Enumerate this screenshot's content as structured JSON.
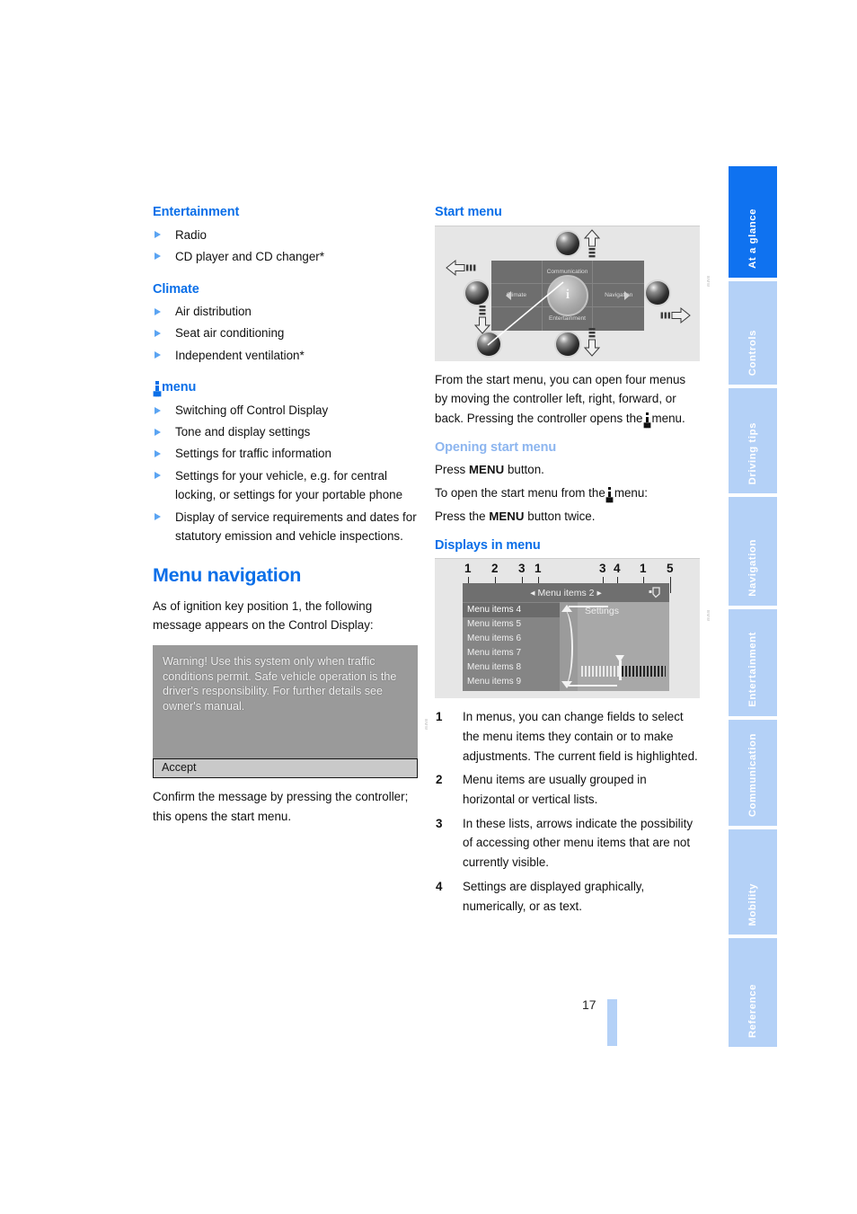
{
  "page": {
    "number": "17"
  },
  "left_column": {
    "groups": [
      {
        "heading": "Entertainment",
        "items": [
          "Radio",
          "CD player and CD changer*"
        ]
      },
      {
        "heading": "Climate",
        "items": [
          "Air distribution",
          "Seat air conditioning",
          "Independent ventilation*"
        ]
      },
      {
        "heading": "menu",
        "heading_icon": "info-i-icon",
        "items": [
          "Switching off Control Display",
          "Tone and display settings",
          "Settings for traffic information",
          "Settings for your vehicle, e.g. for central locking, or settings for your portable phone",
          "Display of service requirements and dates for statutory emission and vehicle inspections."
        ]
      }
    ],
    "section": {
      "title": "Menu navigation",
      "intro": "As of ignition key position 1, the following message appears on the Control Display:",
      "warning_screen": {
        "message": "Warning! Use this system only when traffic conditions permit. Safe vehicle operation is the driver's responsibility. For further details see owner's manual.",
        "button_label": "Accept"
      },
      "outro": "Confirm the message by pressing the controller; this opens the start menu."
    }
  },
  "right_column": {
    "start_menu": {
      "heading": "Start menu",
      "diagram": {
        "top_label": "Communication",
        "left_label": "Climate",
        "right_label": "Navigation",
        "bottom_label": "Entertainment",
        "center_label": "i"
      },
      "paragraph": "From the start menu, you can open four menus by moving the controller left, right, forward, or back. Pressing the controller opens the",
      "paragraph_tail": "menu."
    },
    "opening_start_menu": {
      "heading": "Opening start menu",
      "line1_pre": "Press",
      "line1_button": "MENU",
      "line1_post": "button.",
      "line2_pre": "To open the start menu from the",
      "line2_post": "menu:",
      "line3_pre": "Press the",
      "line3_button": "MENU",
      "line3_post": "button twice."
    },
    "displays_in_menu": {
      "heading": "Displays in menu",
      "callout_numbers": [
        "1",
        "2",
        "3",
        "1",
        "3",
        "4",
        "1",
        "5"
      ],
      "screen": {
        "title": "Menu items 2",
        "left_arrow": "◂",
        "right_arrow": "▸",
        "list_items": [
          "Menu items 4",
          "Menu items 5",
          "Menu items 6",
          "Menu items 7",
          "Menu items 8",
          "Menu items 9"
        ],
        "selected_index": 0,
        "settings_label": "Settings"
      },
      "notes": [
        {
          "num": "1",
          "text": "In menus, you can change fields to select the menu items they contain or to make adjustments. The current field is highlighted."
        },
        {
          "num": "2",
          "text": "Menu items are usually grouped in horizontal or vertical lists."
        },
        {
          "num": "3",
          "text": "In these lists, arrows indicate the possibility of accessing other menu items that are not currently visible."
        },
        {
          "num": "4",
          "text": "Settings are displayed graphically, numerically, or as text."
        }
      ]
    }
  },
  "sidebar": {
    "tabs": [
      {
        "label": "At a glance",
        "active": true
      },
      {
        "label": "Controls",
        "active": false
      },
      {
        "label": "Driving tips",
        "active": false
      },
      {
        "label": "Navigation",
        "active": false
      },
      {
        "label": "Entertainment",
        "active": false
      },
      {
        "label": "Communication",
        "active": false
      },
      {
        "label": "Mobility",
        "active": false
      },
      {
        "label": "Reference",
        "active": false
      }
    ]
  },
  "colors": {
    "accent_blue": "#0b6fe8",
    "light_blue": "#b4d1f7",
    "tab_active": "#0f72f0",
    "heading_light": "#8cb5ef"
  }
}
